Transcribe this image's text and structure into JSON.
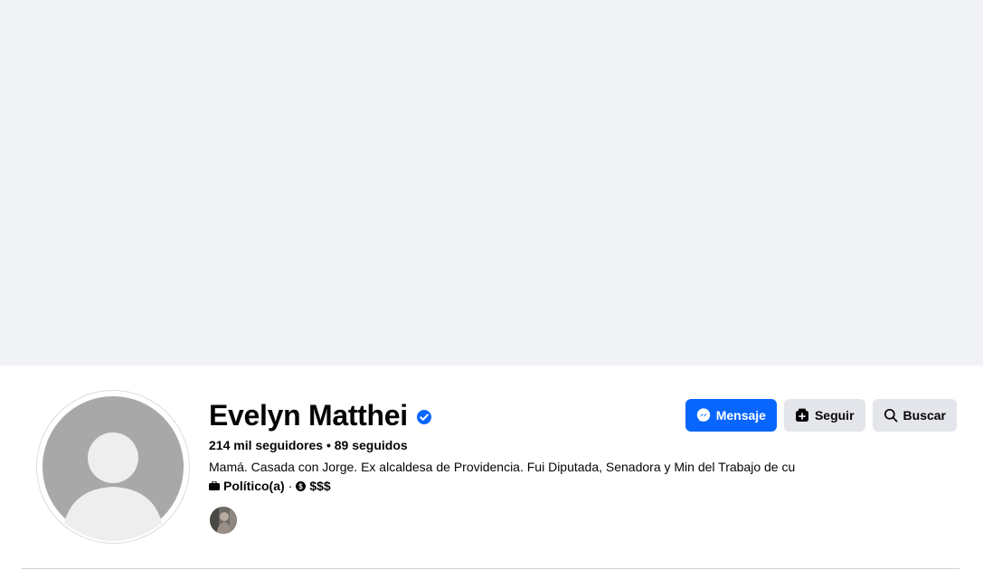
{
  "profile": {
    "name": "Evelyn Matthei",
    "verified_icon": "verified-badge-icon",
    "stats": "214 mil seguidores • 89 seguidos",
    "bio": "Mamá. Casada con Jorge. Ex alcaldesa de Providencia. Fui Diputada, Senadora y Min del Trabajo de cu",
    "category": "Político(a)",
    "separator": "·",
    "price_range": "$$$"
  },
  "actions": {
    "message_label": "Mensaje",
    "follow_label": "Seguir",
    "search_label": "Buscar"
  },
  "colors": {
    "cover_bg": "#f1f2f6",
    "primary": "#0866ff",
    "secondary_button": "#e4e6eb",
    "verified": "#0866ff"
  }
}
